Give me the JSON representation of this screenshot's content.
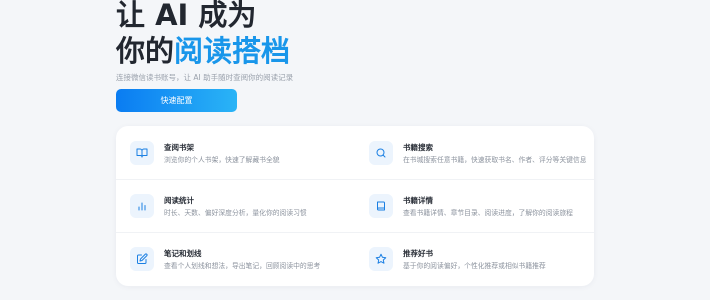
{
  "hero": {
    "line1": "让 AI 成为",
    "line2_prefix": "你的",
    "line2_highlight": "阅读搭档",
    "subtitle": "连接微信读书账号，让 AI 助手随时查阅你的阅读记录",
    "cta_label": "快速配置"
  },
  "colors": {
    "accent": "#1996ea",
    "cta_gradient_start": "#0a7cf2",
    "cta_gradient_end": "#2ab4f6",
    "icon_background": "#ecf4fd"
  },
  "features": [
    {
      "title": "查阅书架",
      "desc": "浏览你的个人书架，快速了解藏书全貌",
      "icon": "book-open-icon"
    },
    {
      "title": "书籍搜索",
      "desc": "在书城搜索任意书籍，快速获取书名、作者、评分等关键信息",
      "icon": "search-icon"
    },
    {
      "title": "阅读统计",
      "desc": "时长、天数、偏好深度分析，量化你的阅读习惯",
      "icon": "bar-chart-icon"
    },
    {
      "title": "书籍详情",
      "desc": "查看书籍详情、章节目录、阅读进度，了解你的阅读旅程",
      "icon": "book-icon"
    },
    {
      "title": "笔记和划线",
      "desc": "查看个人划线和想法，导出笔记，回顾阅读中的思考",
      "icon": "edit-icon"
    },
    {
      "title": "推荐好书",
      "desc": "基于你的阅读偏好，个性化推荐或相似书籍推荐",
      "icon": "star-icon"
    }
  ]
}
